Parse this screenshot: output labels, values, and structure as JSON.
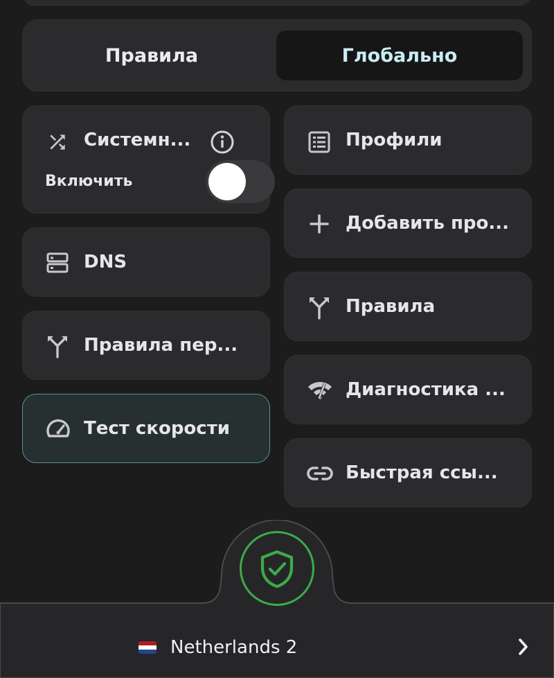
{
  "colors": {
    "background": "#1c1c1d",
    "card": "#2b2b2d",
    "active_card": "#263031",
    "active_border": "#5d8e92",
    "selected_mode_text": "#c9ecf3",
    "shield_green": "#3dab4a"
  },
  "mode_switch": {
    "rules_label": "Правила",
    "global_label": "Глобально",
    "selected": "Глобально"
  },
  "tiles_left": {
    "system_proxy": {
      "label": "Системн...",
      "icon": "shuffle-icon",
      "info_icon": "info-icon",
      "sub_label": "Включить",
      "enabled": false
    },
    "dns": {
      "label": "DNS",
      "icon": "dns-server-icon"
    },
    "override_rules": {
      "label": "Правила пер...",
      "icon": "fork-icon"
    },
    "speed_test": {
      "label": "Тест скорости",
      "icon": "speedometer-icon",
      "active": true
    }
  },
  "tiles_right": {
    "profiles": {
      "label": "Профили",
      "icon": "list-icon"
    },
    "add_profile": {
      "label": "Добавить про...",
      "icon": "plus-icon"
    },
    "rules": {
      "label": "Правила",
      "icon": "fork-icon"
    },
    "diagnostics": {
      "label": "Диагностика ...",
      "icon": "network-diagnostics-icon"
    },
    "quick_link": {
      "label": "Быстрая ссы...",
      "icon": "link-icon"
    }
  },
  "connection": {
    "status_icon": "shield-check-icon",
    "location": "Netherlands 2",
    "flag_colors": [
      "#ae1c28",
      "#ffffff",
      "#21468b"
    ],
    "chevron_icon": "chevron-right-icon"
  }
}
